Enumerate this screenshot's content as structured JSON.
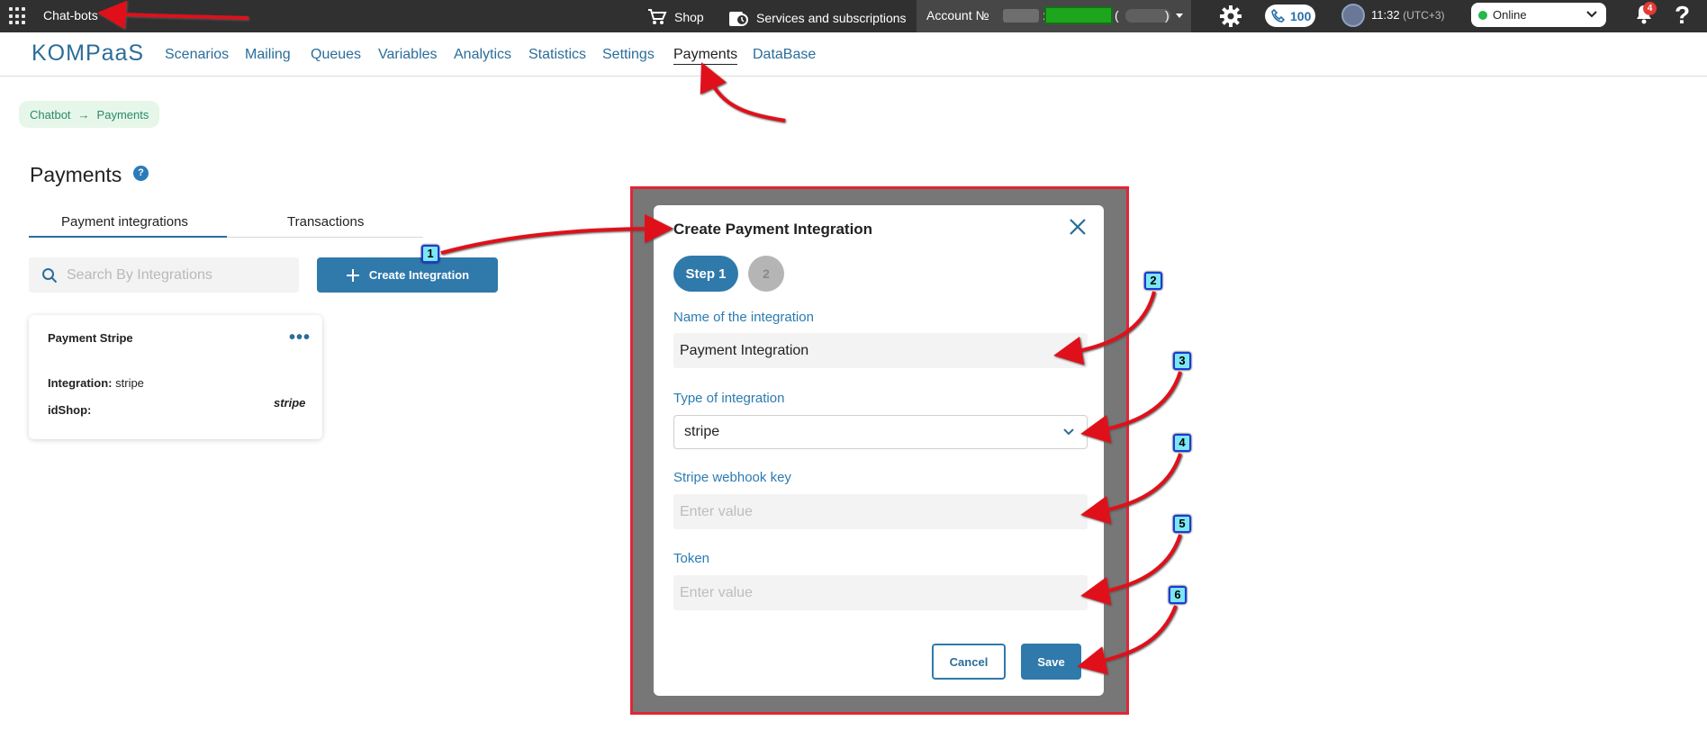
{
  "topbar": {
    "app_title": "Chat-bots",
    "shop_label": "Shop",
    "services_label": "Services and subscriptions",
    "account_label": "Account №",
    "account_colon": ":",
    "account_paren_open": "(",
    "account_paren_close": ")",
    "calls_count": "100",
    "time": "11:32",
    "timezone": "(UTC+3)",
    "status": "Online",
    "notifications_count": "4",
    "help_symbol": "?"
  },
  "nav": {
    "logo": "KOMPaaS",
    "links": [
      "Scenarios",
      "Mailing",
      "Queues",
      "Variables",
      "Analytics",
      "Statistics",
      "Settings",
      "Payments",
      "DataBase"
    ],
    "active": "Payments"
  },
  "breadcrumb": {
    "items": [
      "Chatbot",
      "Payments"
    ],
    "separator": "→"
  },
  "page": {
    "title": "Payments",
    "help_symbol": "?",
    "tabs": [
      "Payment integrations",
      "Transactions"
    ],
    "search_placeholder": "Search By Integrations",
    "create_button": "Create Integration"
  },
  "card": {
    "name": "Payment Stripe",
    "menu": "•••",
    "integration_label": "Integration:",
    "integration_value": "stripe",
    "idshop_label": "idShop:",
    "brand": "stripe"
  },
  "modal": {
    "title": "Create Payment Integration",
    "step1": "Step 1",
    "step2": "2",
    "fields": {
      "name_label": "Name of the integration",
      "name_value": "Payment Integration",
      "type_label": "Type of integration",
      "type_value": "stripe",
      "webhook_label": "Stripe  webhook  key",
      "webhook_placeholder": "Enter value",
      "token_label": "Token",
      "token_placeholder": "Enter value"
    },
    "cancel": "Cancel",
    "save": "Save"
  },
  "callouts": [
    "1",
    "2",
    "3",
    "4",
    "5",
    "6"
  ],
  "colors": {
    "accent": "#2f79ab",
    "topbar": "#303030",
    "annotation_arrow": "#e0101a",
    "annotation_frame": "#e02636",
    "callout_fill": "#7de6f5",
    "callout_border": "#1a3ad8"
  }
}
